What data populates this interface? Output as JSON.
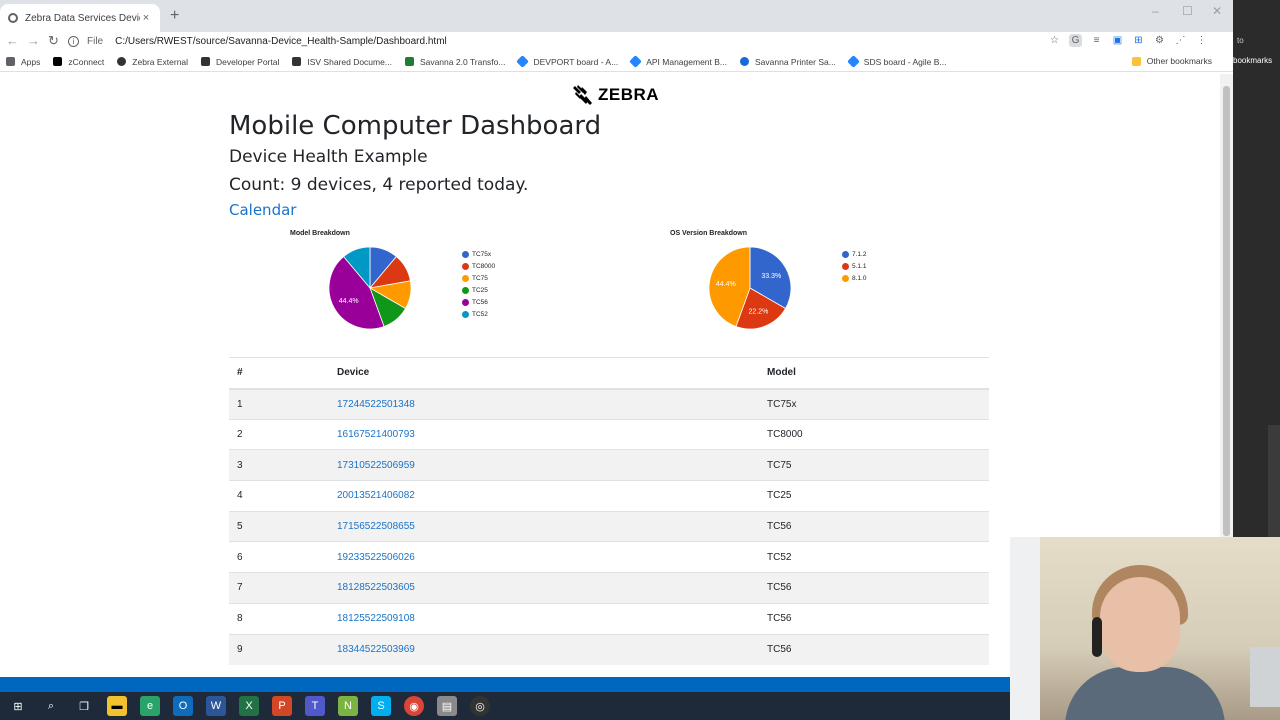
{
  "browser": {
    "tab_title": "Zebra Data Services Device Heal",
    "tab_close": "×",
    "new_tab": "+",
    "window_controls": [
      "–",
      "☐",
      "✕"
    ],
    "nav": {
      "back": "←",
      "forward": "→",
      "reload": "↻"
    },
    "file_label": "File",
    "url": "C:/Users/RWEST/source/Savanna-Device_Health-Sample/Dashboard.html",
    "bookmarks": [
      {
        "label": "Apps",
        "icon": "apps-grid-icon",
        "color": "#5f6368"
      },
      {
        "label": "zConnect",
        "icon": "zconnect-icon",
        "color": "#000000"
      },
      {
        "label": "Zebra External",
        "icon": "zebra-icon",
        "color": "#333333"
      },
      {
        "label": "Developer Portal",
        "icon": "zebra-icon",
        "color": "#333333"
      },
      {
        "label": "ISV Shared Docume...",
        "icon": "zebra-icon",
        "color": "#333333"
      },
      {
        "label": "Savanna 2.0 Transfo...",
        "icon": "green-doc-icon",
        "color": "#1e7d34"
      },
      {
        "label": "DEVPORT board - A...",
        "icon": "jira-icon",
        "color": "#2684ff"
      },
      {
        "label": "API Management B...",
        "icon": "jira-icon",
        "color": "#2684ff"
      },
      {
        "label": "Savanna Printer Sa...",
        "icon": "confluence-icon",
        "color": "#1868db"
      },
      {
        "label": "SDS board - Agile B...",
        "icon": "jira-icon",
        "color": "#2684ff"
      }
    ],
    "other_bookmarks": "Other bookmarks"
  },
  "right_edge": {
    "label": "bookmarks",
    "partial_label": "to"
  },
  "page": {
    "logo_text": "ZEBRA",
    "title": "Mobile Computer Dashboard",
    "subtitle": "Device Health Example",
    "count": "Count: 9 devices, 4 reported today.",
    "calendar_link": "Calendar"
  },
  "colors": {
    "blue": "#3366cc",
    "red": "#dc3912",
    "orange": "#ff9900",
    "green": "#109618",
    "purple": "#990099",
    "teal": "#0099c6",
    "link": "#1a73c8",
    "taskbar_accent": "#0067c0"
  },
  "chart_data": [
    {
      "type": "pie",
      "title": "Model Breakdown",
      "labels": [
        "TC75x",
        "TC8000",
        "TC75",
        "TC25",
        "TC56",
        "TC52"
      ],
      "values": [
        1,
        1,
        1,
        1,
        4,
        1
      ],
      "colors": [
        "#3366cc",
        "#dc3912",
        "#ff9900",
        "#109618",
        "#990099",
        "#0099c6"
      ],
      "slice_labels": [
        "",
        "",
        "",
        "",
        "44.4%",
        ""
      ],
      "legend_position": "right"
    },
    {
      "type": "pie",
      "title": "OS Version Breakdown",
      "labels": [
        "7.1.2",
        "5.1.1",
        "8.1.0"
      ],
      "values": [
        3,
        2,
        4
      ],
      "colors": [
        "#3366cc",
        "#dc3912",
        "#ff9900"
      ],
      "slice_labels": [
        "33.3%",
        "22.2%",
        "44.4%"
      ],
      "legend_position": "right"
    }
  ],
  "table": {
    "headers": [
      "#",
      "Device",
      "Model"
    ],
    "rows": [
      {
        "num": "1",
        "device": "17244522501348",
        "model": "TC75x"
      },
      {
        "num": "2",
        "device": "16167521400793",
        "model": "TC8000"
      },
      {
        "num": "3",
        "device": "17310522506959",
        "model": "TC75"
      },
      {
        "num": "4",
        "device": "20013521406082",
        "model": "TC25"
      },
      {
        "num": "5",
        "device": "17156522508655",
        "model": "TC56"
      },
      {
        "num": "6",
        "device": "19233522506026",
        "model": "TC52"
      },
      {
        "num": "7",
        "device": "18128522503605",
        "model": "TC56"
      },
      {
        "num": "8",
        "device": "18125522509108",
        "model": "TC56"
      },
      {
        "num": "9",
        "device": "18344522503969",
        "model": "TC56"
      }
    ]
  },
  "taskbar": {
    "icons": [
      "windows-start-icon",
      "search-icon",
      "task-view-icon",
      "file-explorer-icon",
      "edge-icon",
      "outlook-icon",
      "word-icon",
      "excel-icon",
      "powerpoint-icon",
      "teams-icon",
      "notepad-icon",
      "skype-icon",
      "chrome-icon",
      "app-icon",
      "obs-icon"
    ]
  }
}
